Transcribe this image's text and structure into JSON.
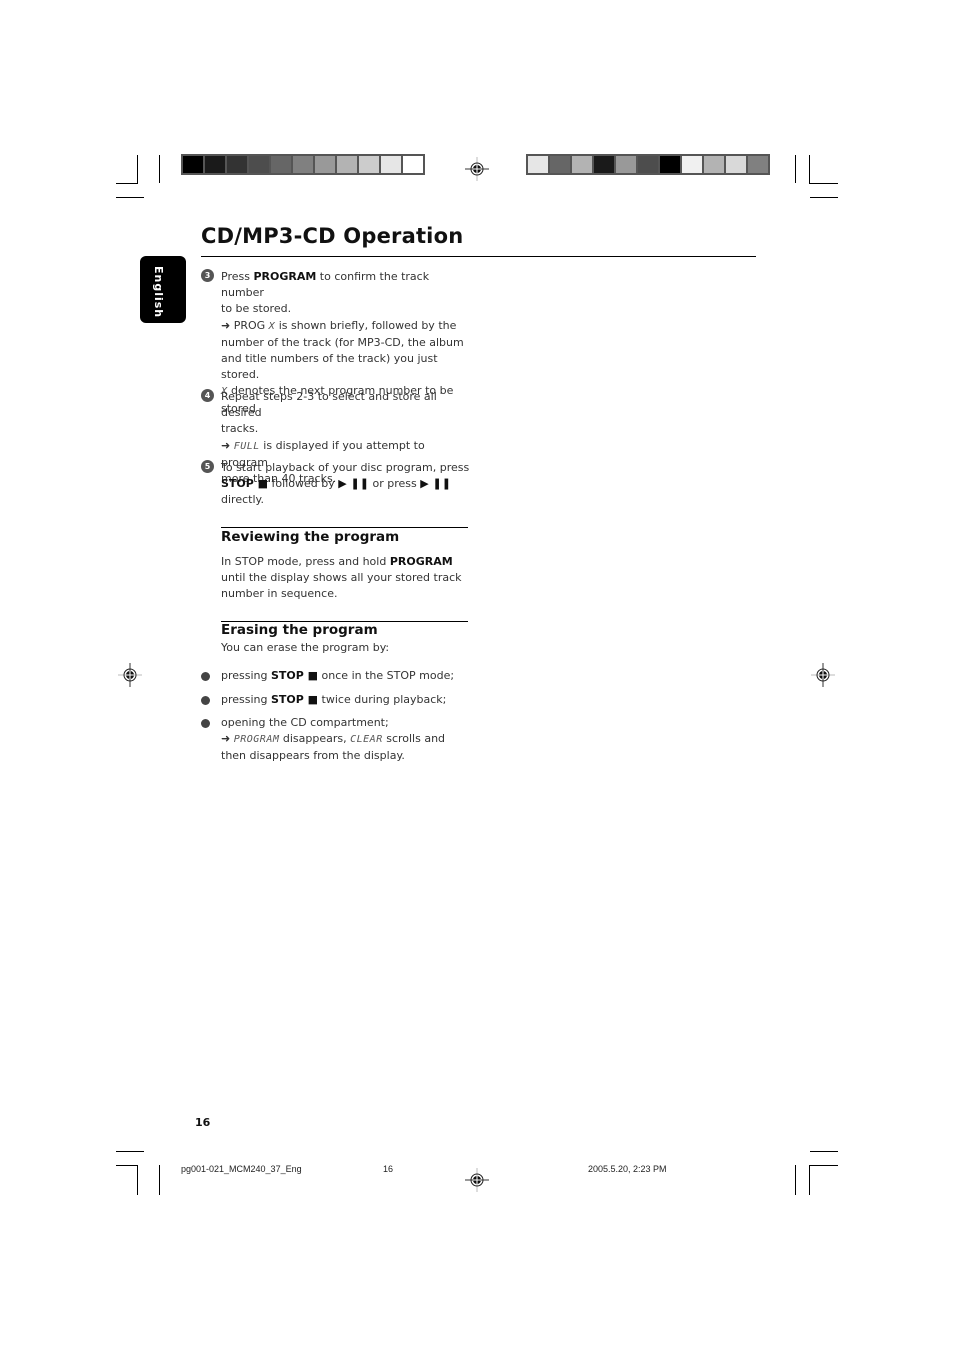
{
  "registration": {
    "colorbar_left": [
      "#000000",
      "#1a1a1a",
      "#333333",
      "#4d4d4d",
      "#666666",
      "#808080",
      "#999999",
      "#b3b3b3",
      "#cccccc",
      "#e6e6e6",
      "#ffffff"
    ],
    "colorbar_right": [
      "#e6e6e6",
      "#666666",
      "#b3b3b3",
      "#1a1a1a",
      "#999999",
      "#4d4d4d",
      "#000000",
      "#f0f0f0",
      "#b3b3b3",
      "#d9d9d9",
      "#808080"
    ]
  },
  "header": {
    "title": "CD/MP3-CD Operation",
    "language_tab": "English"
  },
  "steps": [
    {
      "number": "3",
      "lines": {
        "l1_pre": "Press ",
        "l1_bold": "PROGRAM",
        "l1_post": " to confirm the track number",
        "l2": "to be stored.",
        "l3_arrow": "➜",
        "l3_pre": " PROG ",
        "l3_lcd": "X",
        "l3_post": "  is shown briefly, followed by the",
        "l4": "number of the track (for MP3-CD, the album",
        "l5": "and title numbers of the track) you just stored.",
        "l6_lcd": "X",
        "l6_post": " denotes the next program number to be",
        "l7": "stored"
      }
    },
    {
      "number": "4",
      "lines": {
        "l1": "Repeat steps 2-3 to select and store all desired",
        "l2": "tracks.",
        "l3_arrow": "➜",
        "l3_lcd": "FULL",
        "l3_post": " is displayed if you attempt to program",
        "l4": "more than 40 tracks."
      }
    },
    {
      "number": "5",
      "lines": {
        "l1": "To start playback of your disc program, press",
        "l2_bold": "STOP ■",
        "l2_mid": " followed by ",
        "l2_sym1": "▶ ❚❚",
        "l2_mid2": "  or press ",
        "l2_sym2": "▶ ❚❚",
        "l3": "directly."
      }
    }
  ],
  "reviewing": {
    "heading": "Reviewing the program",
    "l1_pre": "In STOP mode, press and hold ",
    "l1_bold": "PROGRAM",
    "l2": "until the display shows all your stored track",
    "l3": "number in sequence."
  },
  "erasing": {
    "heading": "Erasing the program",
    "intro": "You can erase the program by:",
    "bullets": [
      {
        "pre": "pressing ",
        "bold": "STOP ■",
        "post": " once in the STOP mode;"
      },
      {
        "pre": "pressing ",
        "bold": "STOP ■",
        "post": " twice during playback;"
      },
      {
        "pre": "opening the CD compartment;",
        "arrow": "➜",
        "lcd1": "PROGRAM",
        "mid": " disappears, ",
        "lcd2": "CLEAR",
        "post": " scrolls and",
        "l3": "then disappears from the display."
      }
    ]
  },
  "page_number": "16",
  "footer": {
    "filename": "pg001-021_MCM240_37_Eng",
    "page": "16",
    "timestamp": "2005.5.20, 2:23 PM"
  }
}
